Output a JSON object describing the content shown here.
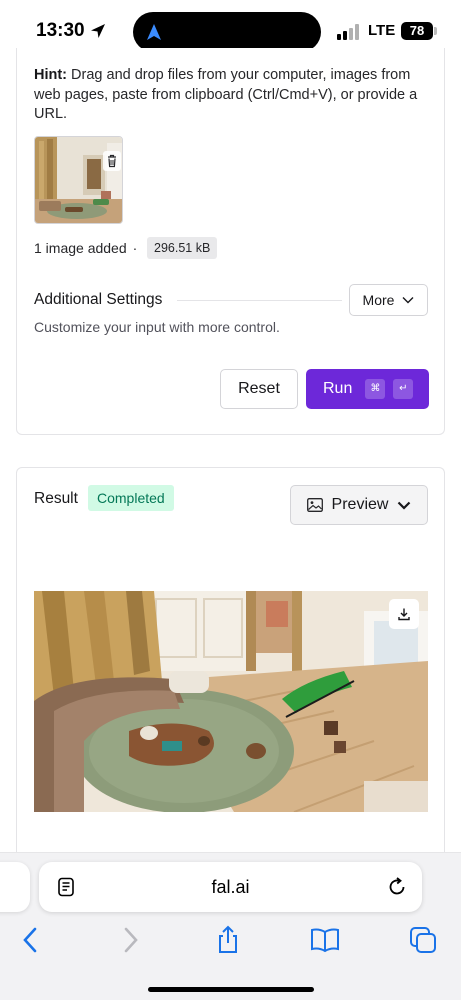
{
  "status_bar": {
    "time": "13:30",
    "network": "LTE",
    "battery": "78"
  },
  "input_card": {
    "hint_label": "Hint:",
    "hint_text": " Drag and drop files from your computer, images from web pages, paste from clipboard (Ctrl/Cmd+V), or provide a URL.",
    "file_count": "1 image added",
    "separator": "·",
    "file_size": "296.51 kB",
    "settings_title": "Additional Settings",
    "more_label": "More",
    "settings_subtitle": "Customize your input with more control.",
    "reset_label": "Reset",
    "run_label": "Run",
    "shortcut_cmd": "⌘",
    "shortcut_enter": "↵"
  },
  "result_card": {
    "title": "Result",
    "status": "Completed",
    "preview_label": "Preview"
  },
  "browser": {
    "url": "fal.ai"
  },
  "colors": {
    "accent": "#6d28d9",
    "status_bg": "#d1fae5",
    "status_text": "#047857"
  },
  "icons": {
    "location": "location-arrow-icon",
    "island_nav": "navigation-icon",
    "trash": "trash-icon",
    "more_chevron": "chevron-down-icon",
    "preview_image": "image-icon",
    "preview_chevron": "chevron-down-icon",
    "download": "download-icon",
    "reader": "reader-mode-icon",
    "reload": "reload-icon",
    "back": "chevron-left-icon",
    "forward": "chevron-right-icon",
    "share": "share-icon",
    "bookmarks": "bookmarks-icon",
    "tabs": "tabs-icon"
  }
}
